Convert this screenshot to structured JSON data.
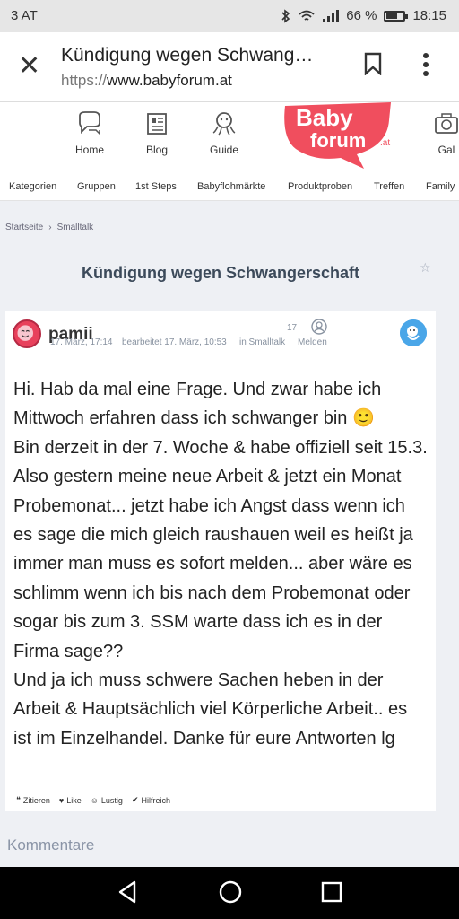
{
  "status": {
    "carrier": "3 AT",
    "battery_text": "66 %",
    "battery_level": 0.66,
    "time": "18:15"
  },
  "browser": {
    "close_icon": "close-icon",
    "tab_title": "Kündigung wegen Schwangerschaft",
    "url_protocol": "https://",
    "url_host": "www.babyforum.at"
  },
  "site_nav": {
    "items": [
      {
        "label": "Home",
        "icon": "chat-icon"
      },
      {
        "label": "Blog",
        "icon": "newspaper-icon"
      },
      {
        "label": "Guide",
        "icon": "octopus-icon"
      },
      {
        "label": "Gal",
        "icon": "camera-icon"
      }
    ],
    "logo_top": "Baby",
    "logo_bottom": "forum",
    "logo_suffix": ".at",
    "logo_color": "#f04e5e"
  },
  "categories": [
    "Kategorien",
    "Gruppen",
    "1st Steps",
    "Babyflohmärkte",
    "Produktproben",
    "Treffen",
    "Family"
  ],
  "breadcrumb": [
    "Startseite",
    "Smalltalk"
  ],
  "page_title": "Kündigung wegen Schwangerschaft",
  "post": {
    "username": "pamii",
    "date": "17. März, 17:14",
    "edited": "bearbeitet 17. März, 10:53",
    "category": "in Smalltalk",
    "report_count": "17",
    "report_label": "Melden",
    "paragraphs": [
      "Hi. Hab da mal eine Frage. Und zwar habe ich Mittwoch erfahren dass ich schwanger bin 🙂",
      "Bin derzeit in der 7. Woche & habe offiziell seit 15.3. Also gestern meine neue Arbeit & jetzt ein Monat Probemonat... jetzt habe ich Angst dass wenn ich es sage die mich gleich raushauen weil es heißt ja immer man muss es sofort melden... aber wäre es schlimm wenn ich bis nach dem Probemonat oder sogar bis zum 3. SSM warte dass ich es in der Firma sage??",
      "Und ja ich muss schwere Sachen heben in der Arbeit & Hauptsächlich viel Körperliche Arbeit.. es ist im Einzelhandel. Danke für eure Antworten lg"
    ],
    "actions": [
      "Zitieren",
      "Like",
      "Lustig",
      "Hilfreich"
    ]
  },
  "comments_heading": "Kommentare"
}
